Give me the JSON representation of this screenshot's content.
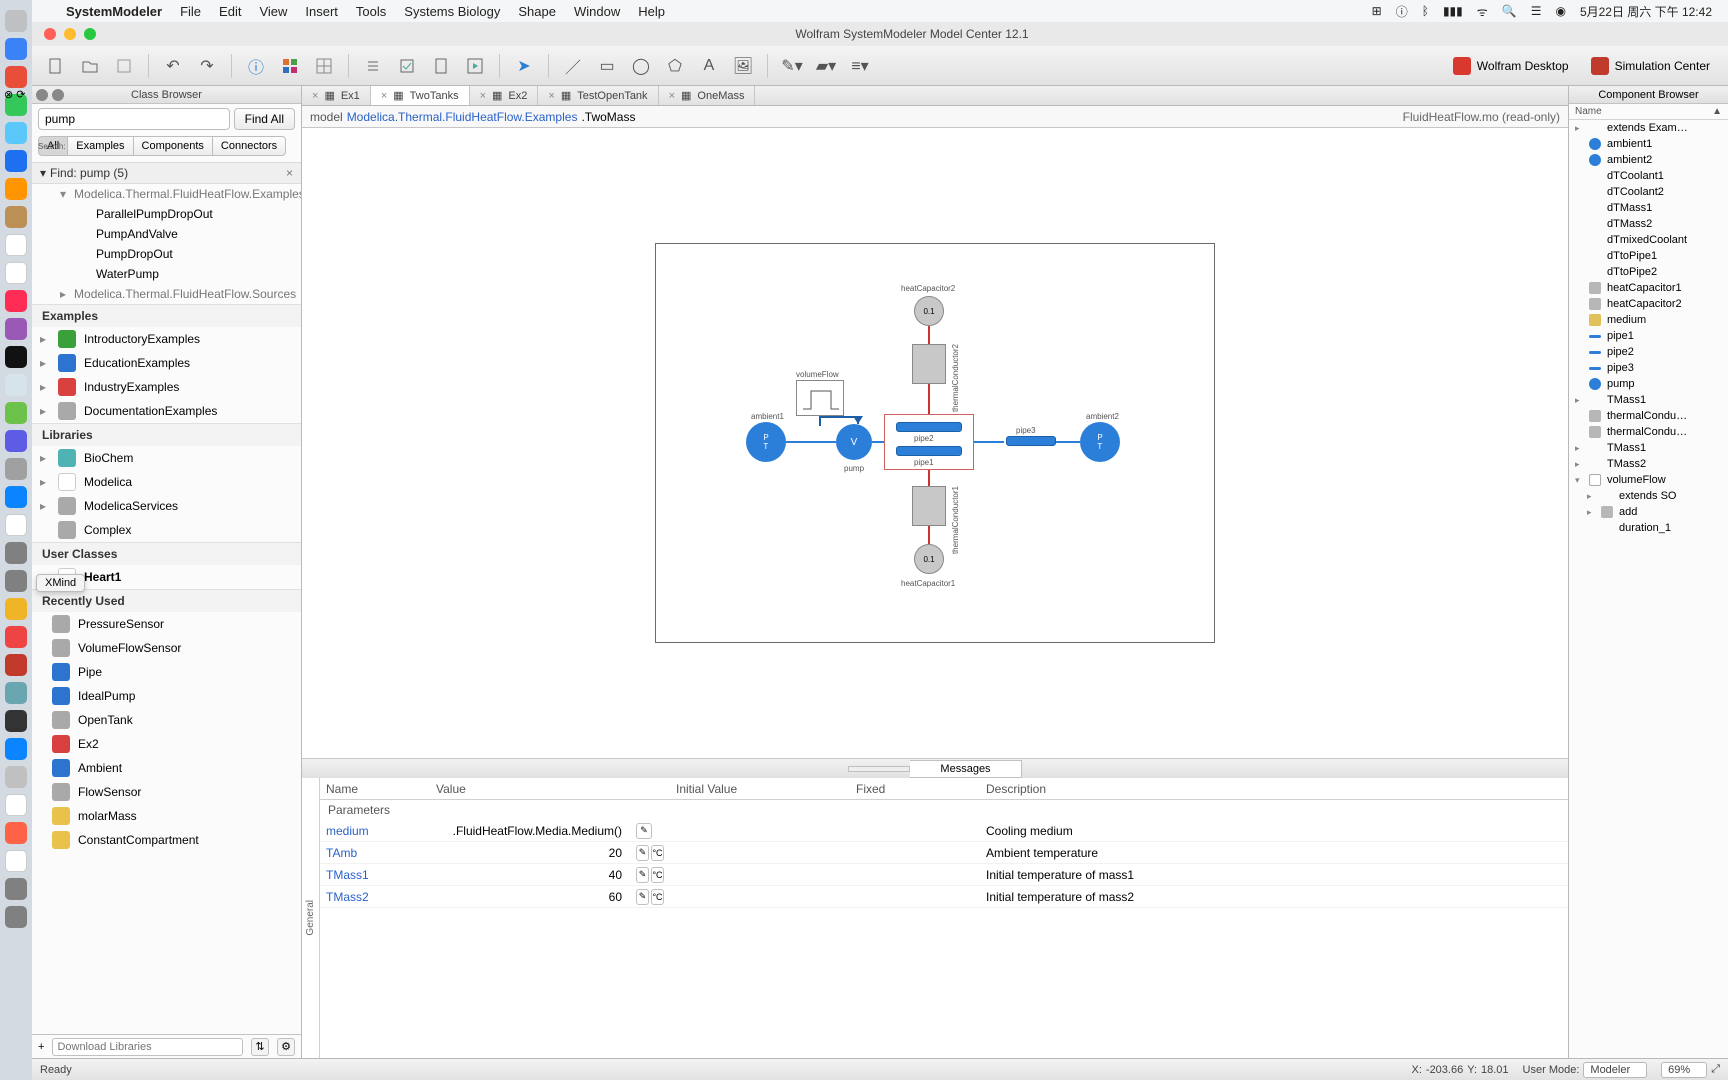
{
  "menubar": {
    "apple": "",
    "app": "SystemModeler",
    "items": [
      "File",
      "Edit",
      "View",
      "Insert",
      "Tools",
      "Systems Biology",
      "Shape",
      "Window",
      "Help"
    ],
    "clock": "5月22日 周六 下午 12:42"
  },
  "window": {
    "title": "Wolfram SystemModeler Model Center 12.1"
  },
  "toolbar_right": {
    "wolfram": "Wolfram Desktop",
    "sim": "Simulation Center"
  },
  "classbrowser": {
    "title": "Class Browser",
    "search_value": "pump",
    "findall": "Find All",
    "search_label": "Search:",
    "filters": [
      "All",
      "Examples",
      "Components",
      "Connectors"
    ],
    "find_header": "Find: pump (5)",
    "find_group": "Modelica.Thermal.FluidHeatFlow.Examples",
    "find_items": [
      "ParallelPumpDropOut",
      "PumpAndValve",
      "PumpDropOut",
      "WaterPump"
    ],
    "find_group2": "Modelica.Thermal.FluidHeatFlow.Sources",
    "cat_examples": "Examples",
    "examples": [
      "IntroductoryExamples",
      "EducationExamples",
      "IndustryExamples",
      "DocumentationExamples"
    ],
    "cat_libs": "Libraries",
    "libs": [
      "BioChem",
      "Modelica",
      "ModelicaServices",
      "Complex"
    ],
    "cat_user": "User Classes",
    "user": [
      "Heart1"
    ],
    "cat_recent": "Recently Used",
    "recent": [
      "PressureSensor",
      "VolumeFlowSensor",
      "Pipe",
      "IdealPump",
      "OpenTank",
      "Ex2",
      "Ambient",
      "FlowSensor",
      "molarMass",
      "ConstantCompartment"
    ],
    "download": "Download Libraries"
  },
  "tabs": [
    "Ex1",
    "TwoTanks",
    "Ex2",
    "TestOpenTank",
    "OneMass"
  ],
  "path": {
    "kw": "model",
    "pkg": "Modelica.Thermal.FluidHeatFlow.Examples",
    "cls": ".TwoMass",
    "file": "FluidHeatFlow.mo (read-only)"
  },
  "diagram": {
    "labels": {
      "heatCap2": "heatCapacitor2",
      "heatCap1": "heatCapacitor1",
      "amb1": "ambient1",
      "amb2": "ambient2",
      "volFlow": "volumeFlow",
      "pump": "pump",
      "pipe1": "pipe1",
      "pipe2": "pipe2",
      "pipe3": "pipe3",
      "thermC2": "thermalConductor2",
      "thermC1": "thermalConductor1",
      "val": "0.1",
      "V": "V",
      "PT": "P\nT"
    }
  },
  "bottomtabs": {
    "blank": "",
    "messages": "Messages"
  },
  "ptable": {
    "headers": [
      "Name",
      "Value",
      "",
      "Initial Value",
      "Fixed",
      "Description"
    ],
    "section": "Parameters",
    "vtab": "General",
    "rows": [
      {
        "name": "medium",
        "value": ".FluidHeatFlow.Media.Medium()",
        "unit": "",
        "desc": "Cooling medium"
      },
      {
        "name": "TAmb",
        "value": "20",
        "unit": "°C",
        "desc": "Ambient temperature"
      },
      {
        "name": "TMass1",
        "value": "40",
        "unit": "°C",
        "desc": "Initial temperature of mass1"
      },
      {
        "name": "TMass2",
        "value": "60",
        "unit": "°C",
        "desc": "Initial temperature of mass2"
      }
    ]
  },
  "compbrowser": {
    "title": "Component Browser",
    "col": "Name",
    "items": [
      "extends Exam…",
      "ambient1",
      "ambient2",
      "dTCoolant1",
      "dTCoolant2",
      "dTMass1",
      "dTMass2",
      "dTmixedCoolant",
      "dTtoPipe1",
      "dTtoPipe2",
      "heatCapacitor1",
      "heatCapacitor2",
      "medium",
      "pipe1",
      "pipe2",
      "pipe3",
      "pump",
      "TMass1",
      "thermalCondu…",
      "thermalCondu…",
      "TMass1",
      "TMass2",
      "volumeFlow",
      "extends SO",
      "add",
      "duration_1"
    ]
  },
  "status": {
    "ready": "Ready",
    "coords_label_x": "X:",
    "x": "-203.66",
    "coords_label_y": "Y:",
    "y": "18.01",
    "usermode_label": "User Mode:",
    "usermode": "Modeler",
    "zoom": "69%"
  },
  "dock_tooltip": "XMind"
}
